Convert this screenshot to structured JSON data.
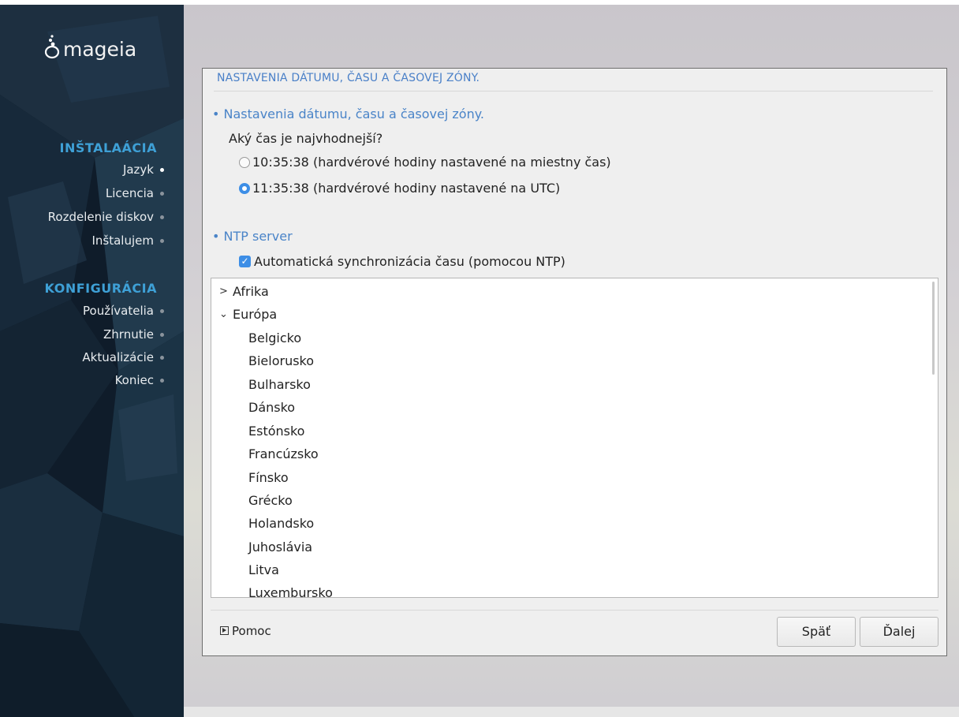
{
  "sidebar": {
    "logo_text": "mageia",
    "sections": [
      {
        "title": "INŠTALAÁCIA",
        "steps": [
          {
            "label": "Jazyk",
            "active": true
          },
          {
            "label": "Licencia",
            "active": false
          },
          {
            "label": "Rozdelenie diskov",
            "active": false
          },
          {
            "label": "Inštalujem",
            "active": false
          }
        ]
      },
      {
        "title": "KONFIGURÁCIA",
        "steps": [
          {
            "label": "Používatelia",
            "active": false
          },
          {
            "label": "Zhrnutie",
            "active": false
          },
          {
            "label": "Aktualizácie",
            "active": false
          },
          {
            "label": "Koniec",
            "active": false
          }
        ]
      }
    ]
  },
  "panel": {
    "title": "NASTAVENIA DÁTUMU, ČASU A ČASOVEJ ZÓNY.",
    "section1_title": "• Nastavenia dátumu, času a časovej zóny.",
    "question": "Aký čas je najvhodnejší?",
    "radio_options": [
      {
        "label": "10:35:38 (hardvérové hodiny nastavené na miestny čas)",
        "checked": false
      },
      {
        "label": "11:35:38 (hardvérové hodiny nastavené na UTC)",
        "checked": true
      }
    ],
    "section2_title": "• NTP server",
    "ntp_checkbox_label": "Automatická synchronizácia času (pomocou NTP)",
    "ntp_checked": true,
    "tree": [
      {
        "label": "Afrika",
        "expander": ">"
      },
      {
        "label": "Európa",
        "expander": "⌄"
      },
      {
        "label": "Belgicko"
      },
      {
        "label": "Bielorusko"
      },
      {
        "label": "Bulharsko"
      },
      {
        "label": "Dánsko"
      },
      {
        "label": "Estónsko"
      },
      {
        "label": "Francúzsko"
      },
      {
        "label": "Fínsko"
      },
      {
        "label": "Grécko"
      },
      {
        "label": "Holandsko"
      },
      {
        "label": "Juhoslávia"
      },
      {
        "label": "Litva"
      },
      {
        "label": "Luxembursko"
      }
    ],
    "help_label": "Pomoc",
    "back_label": "Späť",
    "next_label": "Ďalej"
  },
  "colors": {
    "accent": "#3d8ee6",
    "heading_blue": "#4a84c8",
    "sidebar_section": "#3ea0d6"
  }
}
